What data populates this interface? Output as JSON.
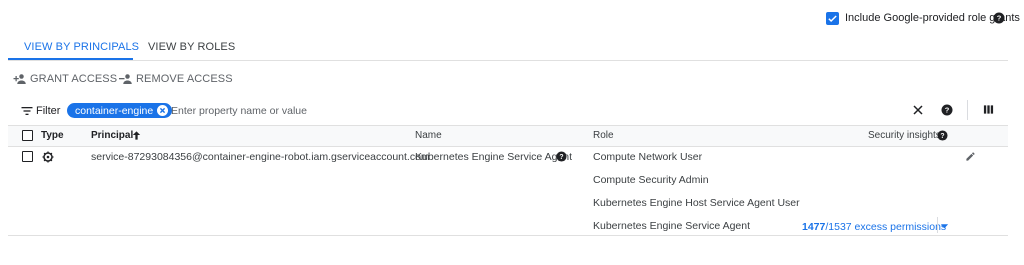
{
  "include_google_grants": {
    "label": "Include Google-provided role grants",
    "checked": true
  },
  "tabs": [
    {
      "label": "VIEW BY PRINCIPALS",
      "active": true
    },
    {
      "label": "VIEW BY ROLES",
      "active": false
    }
  ],
  "actions": {
    "grant": "GRANT ACCESS",
    "remove": "REMOVE ACCESS"
  },
  "filter": {
    "label": "Filter",
    "chip": "container-engine",
    "placeholder": "Enter property name or value"
  },
  "table": {
    "headers": {
      "type": "Type",
      "principal": "Principal",
      "name": "Name",
      "role": "Role",
      "security_insights": "Security insights"
    },
    "rows": [
      {
        "principal": "service-87293084356@container-engine-robot.iam.gserviceaccount.com",
        "name": "Kubernetes Engine Service Agent",
        "roles": [
          "Compute Network User",
          "Compute Security Admin",
          "Kubernetes Engine Host Service Agent User",
          "Kubernetes Engine Service Agent"
        ],
        "insight": {
          "count": "1477",
          "total": "/1537 excess permissions"
        }
      }
    ]
  },
  "icons": {
    "include_checkbox": "checkbox-checked-icon",
    "help": "help-circle-icon",
    "grant": "person-add-icon",
    "remove": "person-remove-icon",
    "filter": "filter-list-icon",
    "chip_close": "cancel-icon",
    "clear": "close-icon",
    "columns": "view-column-icon",
    "sort": "arrow-upward-icon",
    "service_account": "service-account-gear-icon",
    "edit": "pencil-edit-icon",
    "dropdown": "arrow-drop-down-icon"
  },
  "colors": {
    "accent": "#1a73e8",
    "text": "#202124",
    "muted": "#5f6368"
  }
}
